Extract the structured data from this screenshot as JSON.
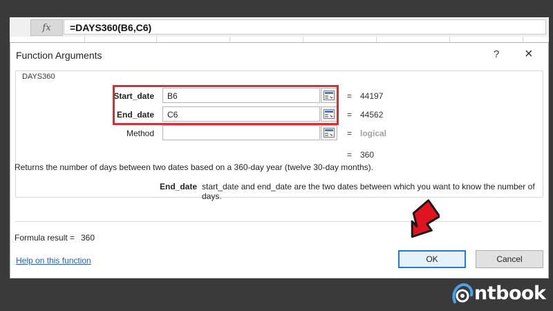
{
  "formula_bar": {
    "fx_label": "fx",
    "formula": "=DAYS360(B6,C6)"
  },
  "dialog": {
    "title": "Function Arguments",
    "help_glyph": "?",
    "close_glyph": "×",
    "function_name": "DAYS360",
    "args": [
      {
        "label": "Start_date",
        "value": "B6",
        "result": "44197"
      },
      {
        "label": "End_date",
        "value": "C6",
        "result": "44562"
      },
      {
        "label": "Method",
        "value": "",
        "result": "logical"
      }
    ],
    "equals": "=",
    "overall_result": "360",
    "description": "Returns the number of days between two dates based on a 360-day year (twelve 30-day months).",
    "arg_help": {
      "name": "End_date",
      "text": "start_date and end_date are the two dates between which you want to know the number of days."
    },
    "formula_result_label": "Formula result =",
    "formula_result_value": "360",
    "help_link": "Help on this function",
    "ok_label": "OK",
    "cancel_label": "Cancel"
  },
  "watermark": {
    "logo_text": "ntbook"
  },
  "colors": {
    "highlight_box": "#d0303a",
    "arrow": "#e0141e",
    "link": "#1f5fbf",
    "ok_border": "#2a78c8"
  }
}
